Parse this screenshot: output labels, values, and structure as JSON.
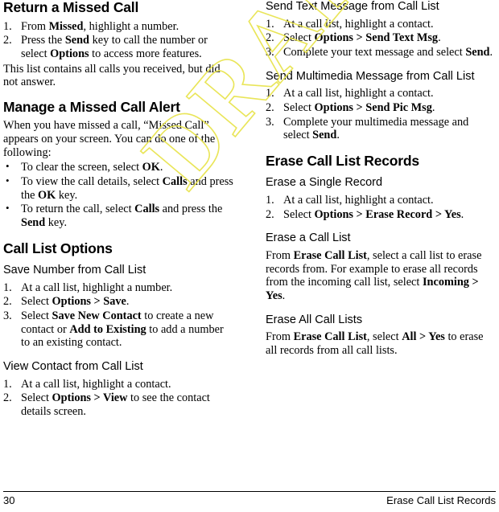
{
  "document": {
    "watermark": "DRAFT",
    "footer": {
      "page_number": "30",
      "running_head": "Erase Call List Records"
    }
  },
  "left_column": {
    "sections": [
      {
        "heading": "Return a Missed Call",
        "steps": [
          {
            "num": "1.",
            "parts": [
              {
                "t": "From "
              },
              {
                "t": "Missed",
                "b": true
              },
              {
                "t": ", highlight a number."
              }
            ]
          },
          {
            "num": "2.",
            "parts": [
              {
                "t": "Press the "
              },
              {
                "t": "Send",
                "b": true
              },
              {
                "t": " key to call the number or select "
              },
              {
                "t": "Options",
                "b": true
              },
              {
                "t": " to access more features."
              }
            ]
          }
        ],
        "paragraph": "This list contains all calls you received, but did not answer."
      },
      {
        "heading": "Manage a Missed Call Alert",
        "paragraph_parts": [
          {
            "t": "When you have missed a call, “Missed Call” appears on your screen. You can do one of the following:"
          }
        ],
        "bullets": [
          [
            {
              "t": "To clear the screen, select "
            },
            {
              "t": "OK",
              "b": true
            },
            {
              "t": "."
            }
          ],
          [
            {
              "t": "To view the call details, select "
            },
            {
              "t": "Calls",
              "b": true
            },
            {
              "t": " and press the "
            },
            {
              "t": "OK",
              "b": true
            },
            {
              "t": " key."
            }
          ],
          [
            {
              "t": "To return the call, select "
            },
            {
              "t": "Calls",
              "b": true
            },
            {
              "t": " and press the "
            },
            {
              "t": "Send",
              "b": true
            },
            {
              "t": " key."
            }
          ]
        ]
      },
      {
        "heading": "Call List Options",
        "subsections": [
          {
            "subheading": "Save Number from Call List",
            "steps": [
              {
                "num": "1.",
                "parts": [
                  {
                    "t": "At a call list, highlight a number."
                  }
                ]
              },
              {
                "num": "2.",
                "parts": [
                  {
                    "t": "Select "
                  },
                  {
                    "t": "Options > Save",
                    "b": true
                  },
                  {
                    "t": "."
                  }
                ]
              },
              {
                "num": "3.",
                "parts": [
                  {
                    "t": "Select "
                  },
                  {
                    "t": "Save New Contact",
                    "b": true
                  },
                  {
                    "t": " to create a new contact or "
                  },
                  {
                    "t": "Add to Existing",
                    "b": true
                  },
                  {
                    "t": " to add a number to an existing contact."
                  }
                ]
              }
            ]
          },
          {
            "subheading": "View Contact from Call List",
            "steps": [
              {
                "num": "1.",
                "parts": [
                  {
                    "t": "At a call list, highlight a contact."
                  }
                ]
              },
              {
                "num": "2.",
                "parts": [
                  {
                    "t": "Select "
                  },
                  {
                    "t": "Options > View",
                    "b": true
                  },
                  {
                    "t": " to see the contact details screen."
                  }
                ]
              }
            ]
          }
        ]
      }
    ]
  },
  "right_column": {
    "sections": [
      {
        "subheading": "Send Text Message from Call List",
        "steps": [
          {
            "num": "1.",
            "parts": [
              {
                "t": "At a call list, highlight a contact."
              }
            ]
          },
          {
            "num": "2.",
            "parts": [
              {
                "t": "Select "
              },
              {
                "t": "Options > Send Text Msg",
                "b": true
              },
              {
                "t": "."
              }
            ]
          },
          {
            "num": "3.",
            "parts": [
              {
                "t": "Complete your text message and select "
              },
              {
                "t": "Send",
                "b": true
              },
              {
                "t": "."
              }
            ]
          }
        ]
      },
      {
        "subheading": "Send Multimedia Message from Call List",
        "steps": [
          {
            "num": "1.",
            "parts": [
              {
                "t": "At a call list, highlight a contact."
              }
            ]
          },
          {
            "num": "2.",
            "parts": [
              {
                "t": "Select "
              },
              {
                "t": "Options > Send Pic Msg",
                "b": true
              },
              {
                "t": "."
              }
            ]
          },
          {
            "num": "3.",
            "parts": [
              {
                "t": "Complete your multimedia message and select "
              },
              {
                "t": "Send",
                "b": true
              },
              {
                "t": "."
              }
            ]
          }
        ]
      },
      {
        "heading": "Erase Call List Records",
        "subsections": [
          {
            "subheading": "Erase a Single Record",
            "steps": [
              {
                "num": "1.",
                "parts": [
                  {
                    "t": "At a call list, highlight a contact."
                  }
                ]
              },
              {
                "num": "2.",
                "parts": [
                  {
                    "t": "Select "
                  },
                  {
                    "t": "Options > Erase Record > Yes",
                    "b": true
                  },
                  {
                    "t": "."
                  }
                ]
              }
            ]
          },
          {
            "subheading": "Erase a Call List",
            "paragraph_parts": [
              {
                "t": "From "
              },
              {
                "t": "Erase Call List",
                "b": true
              },
              {
                "t": ", select a call list to erase records from. For example to erase all records from the incoming call list, select "
              },
              {
                "t": "Incoming > Yes",
                "b": true
              },
              {
                "t": "."
              }
            ]
          },
          {
            "subheading": "Erase All Call Lists",
            "paragraph_parts": [
              {
                "t": "From "
              },
              {
                "t": "Erase Call List",
                "b": true
              },
              {
                "t": ", select "
              },
              {
                "t": "All > Yes",
                "b": true
              },
              {
                "t": " to erase all records from all call lists."
              }
            ]
          }
        ]
      }
    ]
  }
}
